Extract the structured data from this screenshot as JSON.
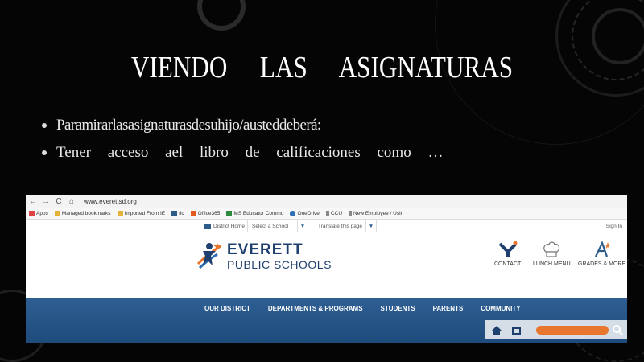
{
  "slide": {
    "title": "VIENDO LAS ASIGNATURAS",
    "bullets": [
      "Paramirarlasasignaturasdesuhijo/austeddeberá:",
      "Tener acceso ael libro de calificaciones como …"
    ]
  },
  "browser": {
    "url": "www.everettsd.org",
    "bookmarks": [
      {
        "label": "Apps",
        "color": "#d44"
      },
      {
        "label": "Managed bookmarks",
        "color": "#e6b33a"
      },
      {
        "label": "Imported From IE",
        "color": "#e6b33a"
      },
      {
        "label": "flc",
        "color": "#2f5d8a"
      },
      {
        "label": "Office365",
        "color": "#e35b1e"
      },
      {
        "label": "MS Educator Commu",
        "color": "#2b8a3e"
      },
      {
        "label": "OneDrive",
        "color": "#2f6fb5"
      },
      {
        "label": "CCU",
        "color": "#888"
      },
      {
        "label": "New Employee / Usin",
        "color": "#888"
      }
    ],
    "utility": {
      "district_home": "District Home",
      "select_school": "Select a School",
      "translate": "Translate this page",
      "sign_in": "Sign In"
    },
    "logo": {
      "line1": "EVERETT",
      "line2": "PUBLIC SCHOOLS"
    },
    "quick_links": {
      "contact": "CONTACT",
      "lunch": "LUNCH MENU",
      "grades": "GRADES & MORE"
    },
    "nav": [
      "OUR DISTRICT",
      "DEPARTMENTS & PROGRAMS",
      "STUDENTS",
      "PARENTS",
      "COMMUNITY"
    ],
    "colors": {
      "brand": "#1f3f6e",
      "nav": "#2f5f93",
      "accent": "#e8762f"
    }
  }
}
